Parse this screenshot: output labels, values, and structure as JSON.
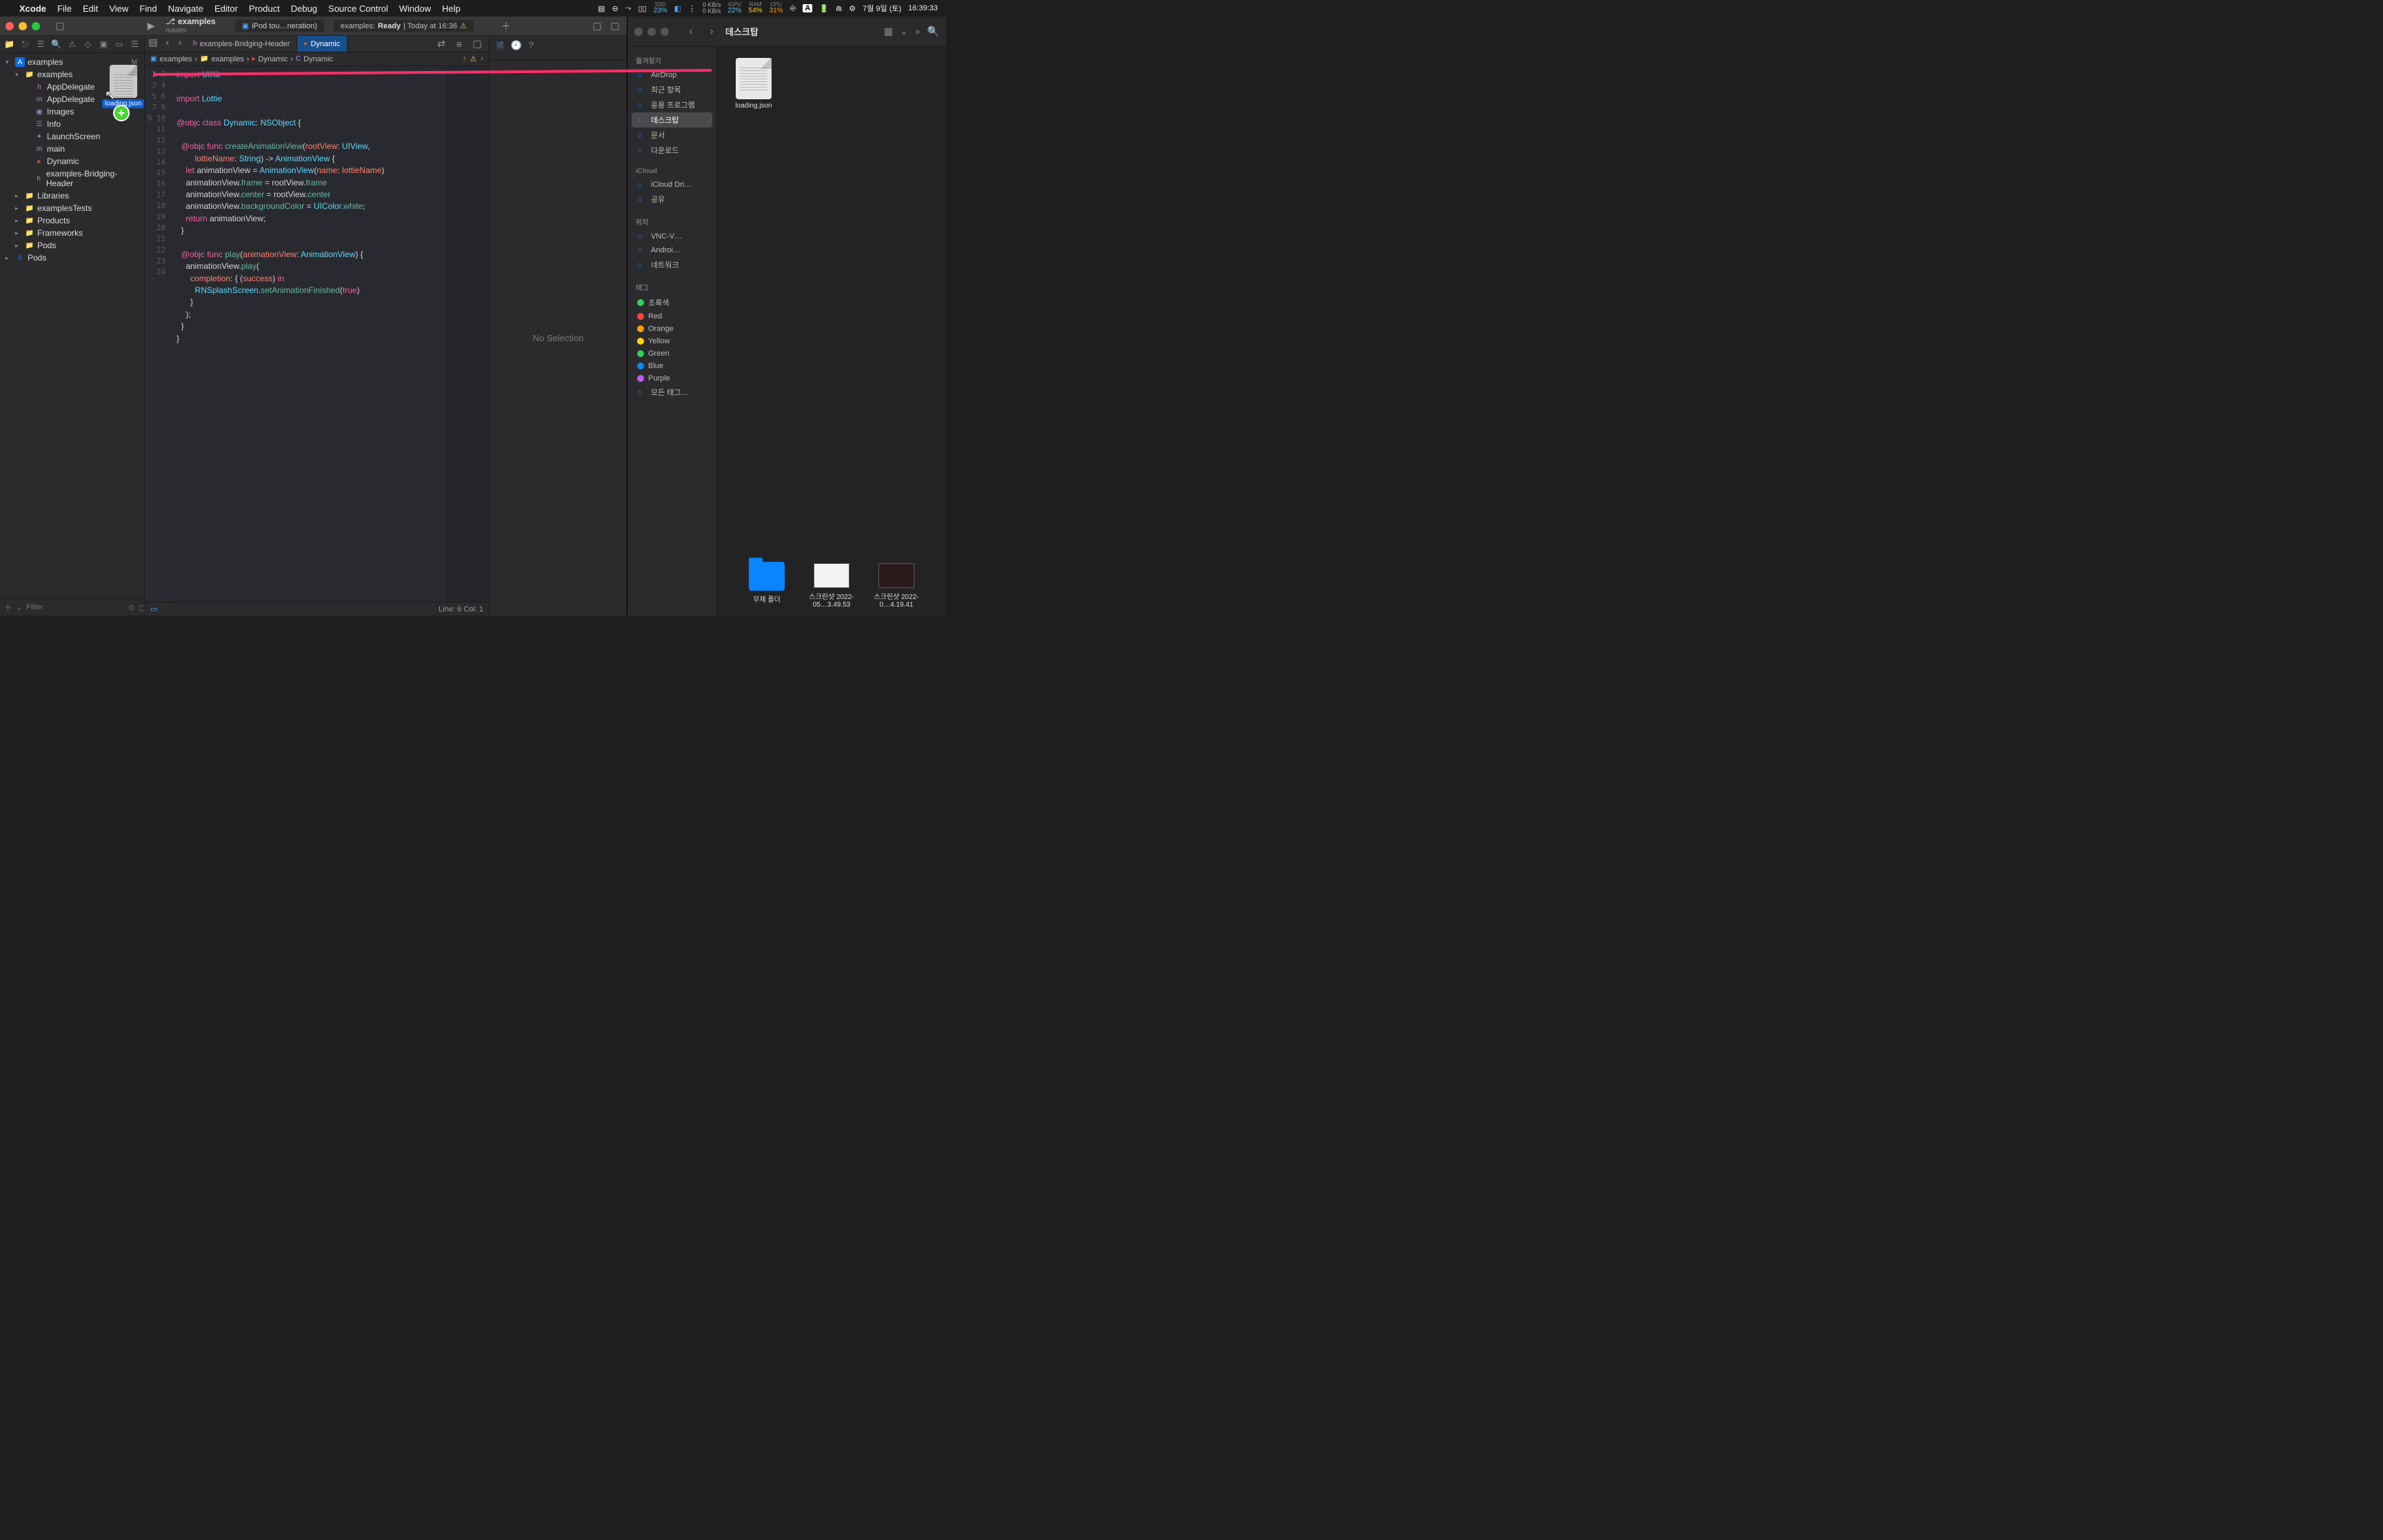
{
  "menubar": {
    "app": "Xcode",
    "items": [
      "File",
      "Edit",
      "View",
      "Find",
      "Navigate",
      "Editor",
      "Product",
      "Debug",
      "Source Control",
      "Window",
      "Help"
    ],
    "stats": {
      "ssd_label": "SSD",
      "ssd_value": "23%",
      "net_up": "0 KB/s",
      "net_down": "0 KB/s",
      "igpu_label": "iGPU",
      "igpu_value": "22%",
      "ram_label": "RAM",
      "ram_value": "54%",
      "cpu_label": "CPU",
      "cpu_value": "31%"
    },
    "lang": "A",
    "date": "7월 9일 (토)",
    "time": "16:39:33"
  },
  "xcode": {
    "title": "examples",
    "branch": "master",
    "scheme": "iPod tou…neration)",
    "status_prefix": "examples:",
    "status_ready": "Ready",
    "status_time": "| Today at 16:36",
    "tabs": [
      {
        "label": "examples-Bridging-Header",
        "icon": "h",
        "active": false
      },
      {
        "label": "Dynamic",
        "icon": "swift",
        "active": true
      }
    ],
    "breadcrumbs": [
      "examples",
      "examples",
      "Dynamic",
      "Dynamic"
    ],
    "navigator": {
      "root": "examples",
      "root_badge": "M",
      "items": [
        {
          "name": "examples",
          "type": "folder",
          "indent": 1,
          "open": true
        },
        {
          "name": "AppDelegate",
          "type": "h",
          "indent": 2
        },
        {
          "name": "AppDelegate",
          "type": "m",
          "indent": 2
        },
        {
          "name": "Images",
          "type": "xcassets",
          "indent": 2
        },
        {
          "name": "Info",
          "type": "plist",
          "indent": 2
        },
        {
          "name": "LaunchScreen",
          "type": "storyboard",
          "indent": 2
        },
        {
          "name": "main",
          "type": "m",
          "indent": 2
        },
        {
          "name": "Dynamic",
          "type": "swift",
          "indent": 2
        },
        {
          "name": "examples-Bridging-Header",
          "type": "h",
          "indent": 2
        },
        {
          "name": "Libraries",
          "type": "folder",
          "indent": 1
        },
        {
          "name": "examplesTests",
          "type": "folder",
          "indent": 1
        },
        {
          "name": "Products",
          "type": "folder",
          "indent": 1
        },
        {
          "name": "Frameworks",
          "type": "folder",
          "indent": 1
        },
        {
          "name": "Pods",
          "type": "folder",
          "indent": 1
        },
        {
          "name": "Pods",
          "type": "project",
          "indent": 0
        }
      ],
      "filter_placeholder": "Filter"
    },
    "code_lines": [
      "import UIKit",
      "",
      "import Lottie",
      "",
      "@objc class Dynamic: NSObject {",
      "",
      "  @objc func createAnimationView(rootView: UIView,",
      "        lottieName: String) -> AnimationView {",
      "    let animationView = AnimationView(name: lottieName)",
      "    animationView.frame = rootView.frame",
      "    animationView.center = rootView.center",
      "    animationView.backgroundColor = UIColor.white;",
      "    return animationView;",
      "  }",
      "",
      "  @objc func play(animationView: AnimationView) {",
      "    animationView.play(",
      "      completion: { (success) in",
      "        RNSplashScreen.setAnimationFinished(true)",
      "      }",
      "    );",
      "  }",
      "}",
      ""
    ],
    "cursor_info": "Line: 6  Col: 1",
    "inspector_empty": "No Selection"
  },
  "finder": {
    "title": "데스크탑",
    "sidebar": {
      "favorites_header": "즐겨찾기",
      "favorites": [
        "AirDrop",
        "최근 항목",
        "응용 프로그램",
        "데스크탑",
        "문서",
        "다운로드"
      ],
      "favorites_selected": "데스크탑",
      "icloud_header": "iCloud",
      "icloud": [
        "iCloud Dri…",
        "공유"
      ],
      "locations_header": "위치",
      "locations": [
        "VNC-V…",
        "Androi…",
        "네트워크"
      ],
      "tags_header": "태그",
      "tags": [
        {
          "label": "초록색",
          "color": "#30d158"
        },
        {
          "label": "Red",
          "color": "#ff453a"
        },
        {
          "label": "Orange",
          "color": "#ff9f0a"
        },
        {
          "label": "Yellow",
          "color": "#ffd60a"
        },
        {
          "label": "Green",
          "color": "#30d158"
        },
        {
          "label": "Blue",
          "color": "#0a84ff"
        },
        {
          "label": "Purple",
          "color": "#bf5af2"
        },
        {
          "label": "모든 태그…",
          "color": ""
        }
      ]
    },
    "items": {
      "top_file": "loading.json",
      "bottom": [
        {
          "name": "무제 폴더",
          "type": "folder"
        },
        {
          "name": "스크린샷 2022-05…3.49.53",
          "type": "screenshot-light"
        },
        {
          "name": "스크린샷 2022-0…4.19.41",
          "type": "screenshot-dark"
        }
      ]
    }
  },
  "drag": {
    "filename": "loading.json"
  }
}
